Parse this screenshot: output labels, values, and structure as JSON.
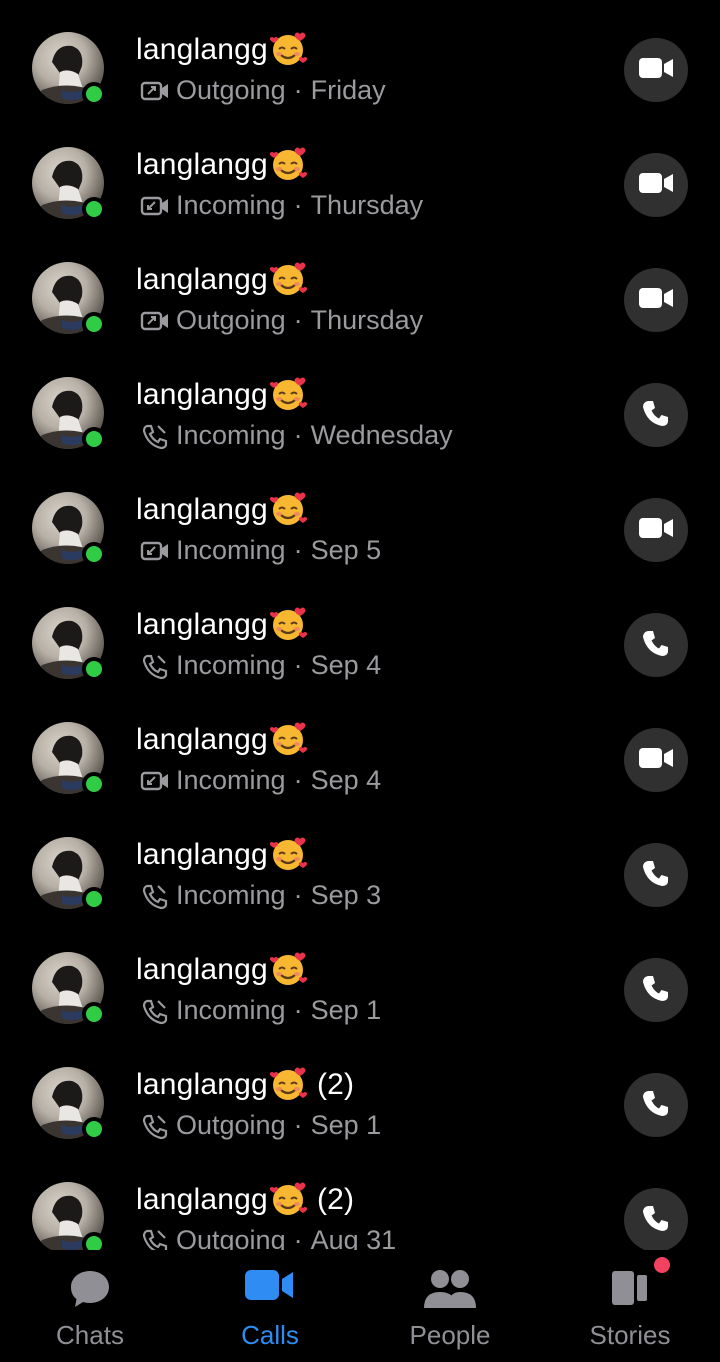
{
  "calls": [
    {
      "name": "langlangg",
      "suffix": "",
      "direction": "Outgoing",
      "when": "Friday",
      "type": "video"
    },
    {
      "name": "langlangg",
      "suffix": "",
      "direction": "Incoming",
      "when": "Thursday",
      "type": "video"
    },
    {
      "name": "langlangg",
      "suffix": "",
      "direction": "Outgoing",
      "when": "Thursday",
      "type": "video"
    },
    {
      "name": "langlangg",
      "suffix": "",
      "direction": "Incoming",
      "when": "Wednesday",
      "type": "audio"
    },
    {
      "name": "langlangg",
      "suffix": "",
      "direction": "Incoming",
      "when": "Sep 5",
      "type": "video"
    },
    {
      "name": "langlangg",
      "suffix": "",
      "direction": "Incoming",
      "when": "Sep 4",
      "type": "audio"
    },
    {
      "name": "langlangg",
      "suffix": "",
      "direction": "Incoming",
      "when": "Sep 4",
      "type": "video"
    },
    {
      "name": "langlangg",
      "suffix": "",
      "direction": "Incoming",
      "when": "Sep 3",
      "type": "audio"
    },
    {
      "name": "langlangg",
      "suffix": "",
      "direction": "Incoming",
      "when": "Sep 1",
      "type": "audio"
    },
    {
      "name": "langlangg",
      "suffix": "(2)",
      "direction": "Outgoing",
      "when": "Sep 1",
      "type": "audio"
    },
    {
      "name": "langlangg",
      "suffix": "(2)",
      "direction": "Outgoing",
      "when": "Aug 31",
      "type": "audio"
    }
  ],
  "separator": "·",
  "tabs": [
    {
      "label": "Chats",
      "icon": "chat-bubble-icon",
      "active": false
    },
    {
      "label": "Calls",
      "icon": "video-camera-icon",
      "active": true
    },
    {
      "label": "People",
      "icon": "people-icon",
      "active": false
    },
    {
      "label": "Stories",
      "icon": "stories-icon",
      "active": false,
      "has_notification": true
    }
  ],
  "colors": {
    "background": "#000000",
    "presence": "#31cc46",
    "accent": "#2f8cf3",
    "muted_text": "#9a9a9f",
    "button_bg": "#303030",
    "notification": "#f3425f"
  }
}
